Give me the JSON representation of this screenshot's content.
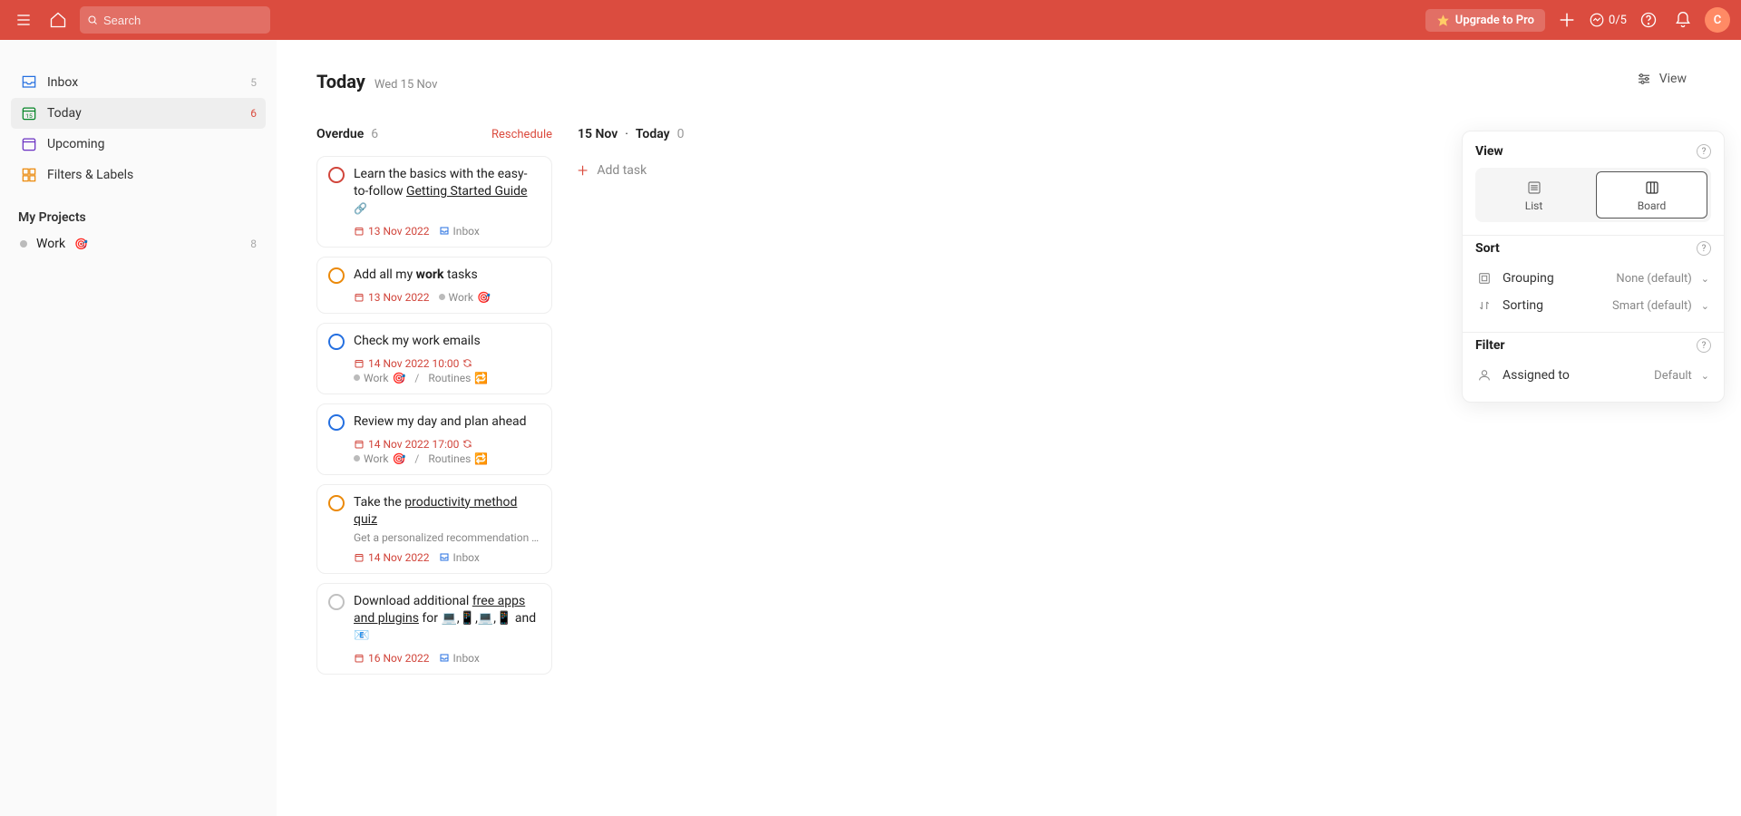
{
  "header": {
    "search_placeholder": "Search",
    "upgrade_label": "Upgrade to Pro",
    "progress": "0/5",
    "avatar_initial": "C"
  },
  "sidebar": {
    "nav": [
      {
        "id": "inbox",
        "label": "Inbox",
        "count": "5"
      },
      {
        "id": "today",
        "label": "Today",
        "count": "6"
      },
      {
        "id": "upcoming",
        "label": "Upcoming",
        "count": ""
      },
      {
        "id": "filters",
        "label": "Filters & Labels",
        "count": ""
      }
    ],
    "projects_title": "My Projects",
    "projects": [
      {
        "label": "Work",
        "emoji": "🎯",
        "count": "8"
      }
    ]
  },
  "page": {
    "title": "Today",
    "subtitle": "Wed 15 Nov",
    "view_button": "View"
  },
  "columns": {
    "overdue": {
      "title": "Overdue",
      "count": "6",
      "reschedule": "Reschedule"
    },
    "today": {
      "title_date": "15 Nov",
      "title_label": "Today",
      "count": "0",
      "add_task": "Add task"
    }
  },
  "tasks": [
    {
      "priority": "p1",
      "title_pre": "Learn the basics with the easy-to-follow ",
      "title_link": "Getting Started Guide",
      "title_post": " ",
      "has_link_icon": true,
      "due": "13 Nov 2022",
      "project": "Inbox",
      "project_type": "inbox"
    },
    {
      "priority": "p2",
      "title_pre": "Add all my ",
      "title_bold": "work",
      "title_post": " tasks",
      "due": "13 Nov 2022",
      "project": "Work",
      "project_emoji": "🎯",
      "project_type": "project"
    },
    {
      "priority": "p3",
      "title_pre": "Check my work emails",
      "due": "14 Nov 2022 10:00",
      "recurring": true,
      "project": "Work",
      "project_emoji": "🎯",
      "project_type": "project",
      "section": "Routines",
      "section_emoji": "🔁"
    },
    {
      "priority": "p3",
      "title_pre": "Review my day and plan ahead",
      "due": "14 Nov 2022 17:00",
      "recurring": true,
      "project": "Work",
      "project_emoji": "🎯",
      "project_type": "project",
      "section": "Routines",
      "section_emoji": "🔁"
    },
    {
      "priority": "p2",
      "title_pre": "Take the ",
      "title_link": "productivity method quiz",
      "desc": "Get a personalized recommendation f…",
      "due": "14 Nov 2022",
      "project": "Inbox",
      "project_type": "inbox"
    },
    {
      "priority": "p4",
      "title_pre": "Download additional ",
      "title_link": "free apps and plugins",
      "title_post": " for 💻,📱,💻,📱 and 📧",
      "due": "16 Nov 2022",
      "project": "Inbox",
      "project_type": "inbox"
    }
  ],
  "view_panel": {
    "view_title": "View",
    "list_label": "List",
    "board_label": "Board",
    "sort_title": "Sort",
    "grouping_label": "Grouping",
    "grouping_value": "None (default)",
    "sorting_label": "Sorting",
    "sorting_value": "Smart (default)",
    "filter_title": "Filter",
    "assigned_label": "Assigned to",
    "assigned_value": "Default"
  }
}
